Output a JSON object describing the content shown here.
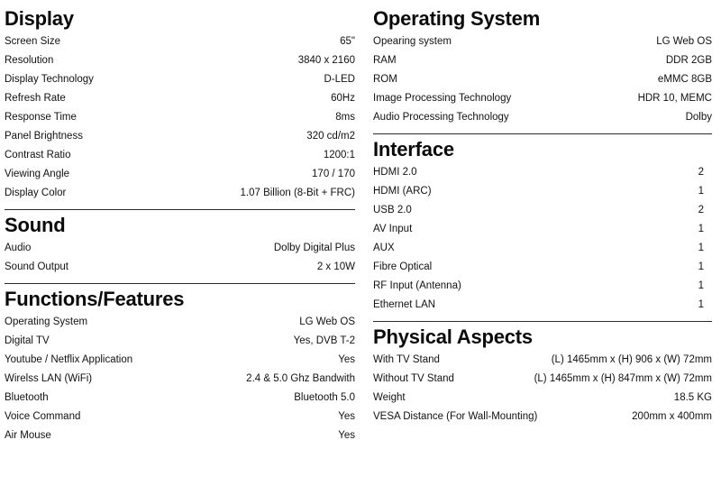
{
  "document": {
    "type": "tv-specification-sheet"
  },
  "columns": {
    "left": [
      {
        "id": "display",
        "title": "Display",
        "divider_above": false,
        "rows": [
          {
            "label": "Screen Size",
            "value": "65\""
          },
          {
            "label": "Resolution",
            "value": "3840 x 2160"
          },
          {
            "label": "Display Technology",
            "value": "D-LED"
          },
          {
            "label": "Refresh Rate",
            "value": "60Hz"
          },
          {
            "label": "Response Time",
            "value": "8ms"
          },
          {
            "label": "Panel Brightness",
            "value": "320 cd/m2"
          },
          {
            "label": "Contrast Ratio",
            "value": "1200:1"
          },
          {
            "label": "Viewing Angle",
            "value": "170 / 170"
          },
          {
            "label": "Display Color",
            "value": "1.07 Billion (8-Bit + FRC)"
          }
        ]
      },
      {
        "id": "sound",
        "title": "Sound",
        "divider_above": true,
        "rows": [
          {
            "label": "Audio",
            "value": "Dolby Digital Plus"
          },
          {
            "label": "Sound Output",
            "value": "2 x 10W"
          }
        ]
      },
      {
        "id": "functions-features",
        "title": "Functions/Features",
        "divider_above": true,
        "rows": [
          {
            "label": "Operating System",
            "value": "LG Web OS"
          },
          {
            "label": "Digital TV",
            "value": "Yes, DVB T-2"
          },
          {
            "label": "Youtube / Netflix Application",
            "value": "Yes"
          },
          {
            "label": "Wirelss LAN (WiFi)",
            "value": "2.4 & 5.0 Ghz Bandwith"
          },
          {
            "label": "Bluetooth",
            "value": "Bluetooth 5.0"
          },
          {
            "label": "Voice Command",
            "value": "Yes"
          },
          {
            "label": "Air Mouse",
            "value": "Yes"
          }
        ]
      }
    ],
    "right": [
      {
        "id": "operating-system",
        "title": "Operating System",
        "divider_above": false,
        "rows": [
          {
            "label": "Opearing system",
            "value": "LG Web OS"
          },
          {
            "label": "RAM",
            "value": "DDR 2GB"
          },
          {
            "label": "ROM",
            "value": "eMMC 8GB"
          },
          {
            "label": "Image Processing Technology",
            "value": "HDR 10, MEMC"
          },
          {
            "label": "Audio Processing Technology",
            "value": "Dolby"
          }
        ]
      },
      {
        "id": "interface",
        "title": "Interface",
        "divider_above": true,
        "rows": [
          {
            "label": "HDMI 2.0",
            "value": "2"
          },
          {
            "label": "HDMI (ARC)",
            "value": "1"
          },
          {
            "label": "USB 2.0",
            "value": "2"
          },
          {
            "label": "AV Input",
            "value": "1"
          },
          {
            "label": "AUX",
            "value": "1"
          },
          {
            "label": "Fibre Optical",
            "value": "1"
          },
          {
            "label": "RF Input (Antenna)",
            "value": "1"
          },
          {
            "label": "Ethernet LAN",
            "value": "1"
          }
        ]
      },
      {
        "id": "physical-aspects",
        "title": "Physical Aspects",
        "divider_above": true,
        "rows": [
          {
            "label": "With TV Stand",
            "value": "(L) 1465mm x (H) 906 x (W) 72mm"
          },
          {
            "label": "Without TV Stand",
            "value": "(L) 1465mm x (H) 847mm x (W) 72mm"
          },
          {
            "label": "Weight",
            "value": "18.5 KG"
          },
          {
            "label": "VESA Distance (For Wall-Mounting)",
            "value": "200mm x 400mm"
          }
        ]
      }
    ]
  },
  "colors": {
    "background": "#ffffff",
    "text": "#111111",
    "divider": "#2b2b2b"
  }
}
